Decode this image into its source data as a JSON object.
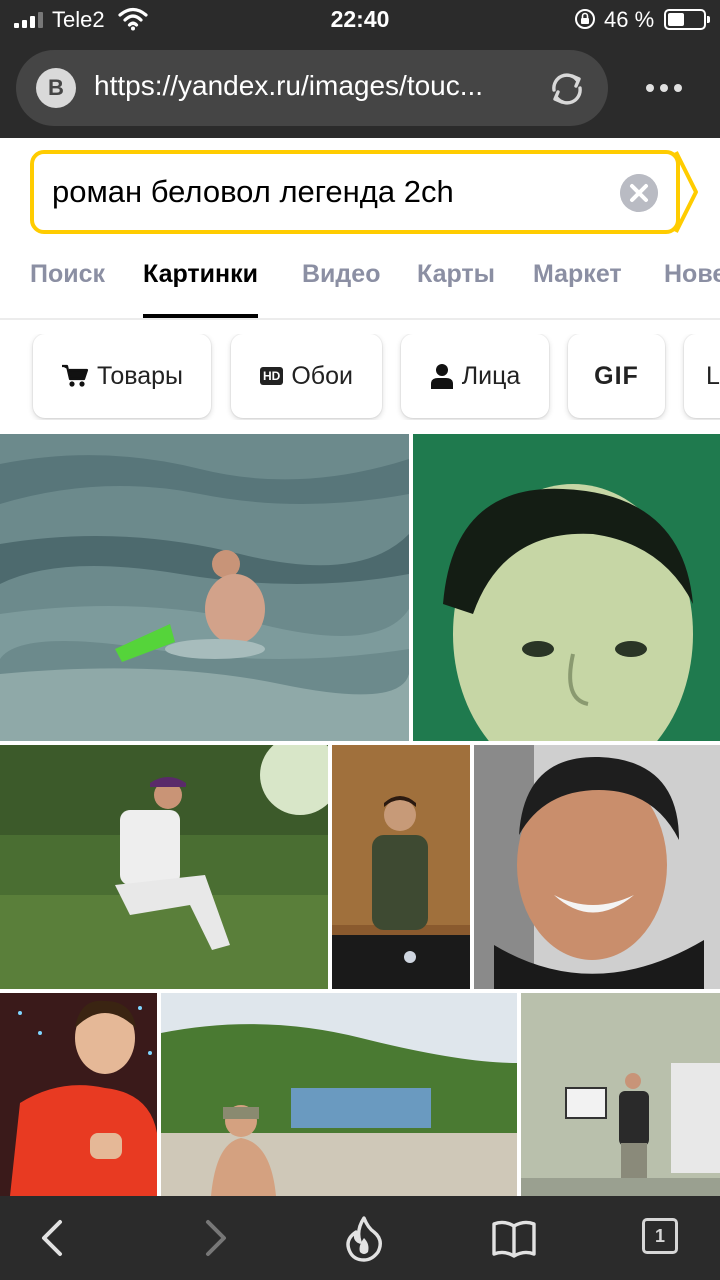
{
  "status_bar": {
    "carrier": "Tele2",
    "time": "22:40",
    "battery_percent": "46 %",
    "battery_level": 0.46
  },
  "browser": {
    "site_badge": "B",
    "url": "https://yandex.ru/images/touc...",
    "open_tabs": "1"
  },
  "search": {
    "query": "роман беловол легенда 2ch",
    "accent_color": "#ffcc00"
  },
  "tabs": [
    {
      "label": "Поиск",
      "active": false
    },
    {
      "label": "Картинки",
      "active": true
    },
    {
      "label": "Видео",
      "active": false
    },
    {
      "label": "Карты",
      "active": false
    },
    {
      "label": "Маркет",
      "active": false
    },
    {
      "label": "Нове",
      "active": false
    }
  ],
  "filters": [
    {
      "label": "Товары",
      "icon": "cart-icon"
    },
    {
      "label": "Обои",
      "icon": "hd-icon",
      "badge": "HD"
    },
    {
      "label": "Лица",
      "icon": "person-icon"
    },
    {
      "label": "GIF",
      "icon": null
    },
    {
      "label": "L",
      "icon": null
    }
  ],
  "images": [
    {
      "subject": "man in sea waves"
    },
    {
      "subject": "face on green background"
    },
    {
      "subject": "man sitting on grass"
    },
    {
      "subject": "man taking mirror selfie"
    },
    {
      "subject": "smiling man with scarf"
    },
    {
      "subject": "man in red t-shirt thumbs up"
    },
    {
      "subject": "man at seaside with hills"
    },
    {
      "subject": "man at industrial site"
    }
  ],
  "toolbar": {
    "icons": [
      "back-icon",
      "forward-icon",
      "flame-icon",
      "book-icon",
      "tabs-icon"
    ]
  }
}
